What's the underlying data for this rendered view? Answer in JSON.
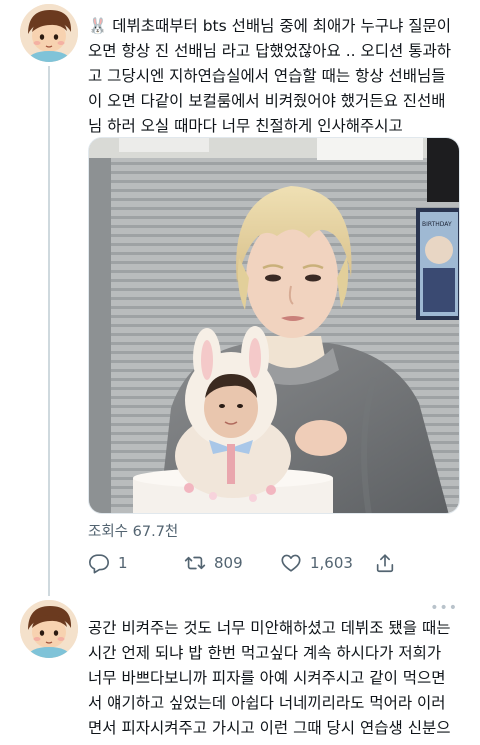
{
  "tweets": [
    {
      "more_label": "•••",
      "text": "🐰 데뷔초때부터 bts 선배님 중에 최애가 누구냐 질문이 오면 항상 진 선배님 라고 답했었잖아요 .. 오디션 통과하고 그당시엔 지하연습실에서 연습할 때는 항상 선배님들이 오면 다같이 보컬룸에서 비켜줬어야 했거든요 진선배님 하러 오실 때마다 너무 친절하게 인사해주시고",
      "views": "조회수 67.7천",
      "replies": "1",
      "retweets": "809",
      "likes": "1,603",
      "image": {
        "poster_text": "BIRTHDAY",
        "subject": "person holding bunny cake"
      }
    },
    {
      "more_label": "•••",
      "text": "공간 비켜주는 것도 너무 미안해하셨고 데뷔조 됐을 때는 시간 언제 되냐 밥 한번 먹고싶다 계속 하시다가 저희가 너무 바쁘다보니까 피자를 아예 시켜주시고 같이 먹으면서 얘기하고 싶었는데 아쉽다 너네끼리라도 먹어라 이러면서 피자시켜주고 가시고 이런 그때 당시 연습생 신분으로썬 너무 감동적"
    }
  ],
  "icons": {
    "reply": "speech-bubble-icon",
    "retweet": "retweet-arrows-icon",
    "like": "heart-icon",
    "share": "share-upload-icon"
  },
  "colors": {
    "text": "#0f1419",
    "secondary": "#536471",
    "thread_line": "#cfd9de"
  }
}
